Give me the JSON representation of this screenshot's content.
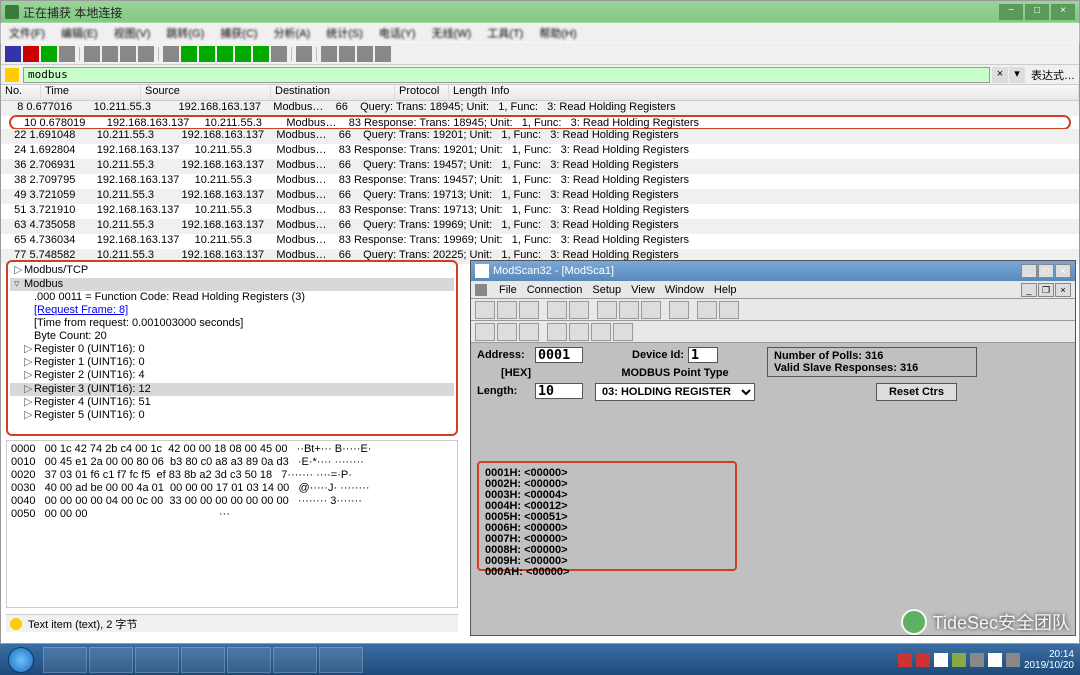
{
  "wireshark": {
    "title": "正在捕获 本地连接",
    "menu": [
      "文件(F)",
      "编辑(E)",
      "视图(V)",
      "跳转(G)",
      "捕获(C)",
      "分析(A)",
      "统计(S)",
      "电话(Y)",
      "无线(W)",
      "工具(T)",
      "帮助(H)"
    ],
    "filter": {
      "value": "modbus",
      "expr_label": "表达式…"
    },
    "columns": {
      "no": "No.",
      "time": "Time",
      "src": "Source",
      "dst": "Destination",
      "proto": "Protocol",
      "len": "Length",
      "info": "Info"
    },
    "packets": [
      {
        "no": "8",
        "time": "0.677016",
        "src": "10.211.55.3",
        "dst": "192.168.163.137",
        "proto": "Modbus…",
        "len": "66",
        "info": "   Query: Trans: 18945; Unit:   1, Func:   3: Read Holding Registers",
        "sel": false,
        "alt": true
      },
      {
        "no": "10",
        "time": "0.678019",
        "src": "192.168.163.137",
        "dst": "10.211.55.3",
        "proto": "Modbus…",
        "len": "83",
        "info": "Response: Trans: 18945; Unit:   1, Func:   3: Read Holding Registers",
        "sel": true,
        "alt": false
      },
      {
        "no": "22",
        "time": "1.691048",
        "src": "10.211.55.3",
        "dst": "192.168.163.137",
        "proto": "Modbus…",
        "len": "66",
        "info": "   Query: Trans: 19201; Unit:   1, Func:   3: Read Holding Registers",
        "sel": false,
        "alt": true
      },
      {
        "no": "24",
        "time": "1.692804",
        "src": "192.168.163.137",
        "dst": "10.211.55.3",
        "proto": "Modbus…",
        "len": "83",
        "info": "Response: Trans: 19201; Unit:   1, Func:   3: Read Holding Registers",
        "sel": false,
        "alt": false
      },
      {
        "no": "36",
        "time": "2.706931",
        "src": "10.211.55.3",
        "dst": "192.168.163.137",
        "proto": "Modbus…",
        "len": "66",
        "info": "   Query: Trans: 19457; Unit:   1, Func:   3: Read Holding Registers",
        "sel": false,
        "alt": true
      },
      {
        "no": "38",
        "time": "2.709795",
        "src": "192.168.163.137",
        "dst": "10.211.55.3",
        "proto": "Modbus…",
        "len": "83",
        "info": "Response: Trans: 19457; Unit:   1, Func:   3: Read Holding Registers",
        "sel": false,
        "alt": false
      },
      {
        "no": "49",
        "time": "3.721059",
        "src": "10.211.55.3",
        "dst": "192.168.163.137",
        "proto": "Modbus…",
        "len": "66",
        "info": "   Query: Trans: 19713; Unit:   1, Func:   3: Read Holding Registers",
        "sel": false,
        "alt": true
      },
      {
        "no": "51",
        "time": "3.721910",
        "src": "192.168.163.137",
        "dst": "10.211.55.3",
        "proto": "Modbus…",
        "len": "83",
        "info": "Response: Trans: 19713; Unit:   1, Func:   3: Read Holding Registers",
        "sel": false,
        "alt": false
      },
      {
        "no": "63",
        "time": "4.735058",
        "src": "10.211.55.3",
        "dst": "192.168.163.137",
        "proto": "Modbus…",
        "len": "66",
        "info": "   Query: Trans: 19969; Unit:   1, Func:   3: Read Holding Registers",
        "sel": false,
        "alt": true
      },
      {
        "no": "65",
        "time": "4.736034",
        "src": "192.168.163.137",
        "dst": "10.211.55.3",
        "proto": "Modbus…",
        "len": "83",
        "info": "Response: Trans: 19969; Unit:   1, Func:   3: Read Holding Registers",
        "sel": false,
        "alt": false
      },
      {
        "no": "77",
        "time": "5.748582",
        "src": "10.211.55.3",
        "dst": "192.168.163.137",
        "proto": "Modbus…",
        "len": "66",
        "info": "   Query: Trans: 20225; Unit:   1, Func:   3: Read Holding Registers",
        "sel": false,
        "alt": true
      }
    ],
    "detail": {
      "l0": "Modbus/TCP",
      "l1": "Modbus",
      "l2": ".000 0011 = Function Code: Read Holding Registers (3)",
      "l3": "[Request Frame: 8]",
      "l4": "[Time from request: 0.001003000 seconds]",
      "l5": "Byte Count: 20",
      "l6": "Register 0 (UINT16): 0",
      "l7": "Register 1 (UINT16): 0",
      "l8": "Register 2 (UINT16): 4",
      "l9": "Register 3 (UINT16): 12",
      "l10": "Register 4 (UINT16): 51",
      "l11": "Register 5 (UINT16): 0"
    },
    "hex": [
      "0000   00 1c 42 74 2b c4 00 1c  42 00 00 18 08 00 45 00   ··Bt+··· B·····E·",
      "0010   00 45 e1 2a 00 00 80 06  b3 80 c0 a8 a3 89 0a d3   ·E·*···· ········",
      "0020   37 03 01 f6 c1 f7 fc f5  ef 83 8b a2 3d c3 50 18   7······· ····=·P·",
      "0030   40 00 ad be 00 00 4a 01  00 00 00 17 01 03 14 00   @·····J· ········",
      "0040   00 00 00 00 04 00 0c 00  33 00 00 00 00 00 00 00   ········ 3·······",
      "0050   00 00 00                                           ···"
    ],
    "status": "Text item (text), 2 字节"
  },
  "modscan": {
    "title": "ModScan32 - [ModSca1]",
    "menu": [
      "File",
      "Connection",
      "Setup",
      "View",
      "Window",
      "Help"
    ],
    "labels": {
      "address": "Address:",
      "hex": "[HEX]",
      "length": "Length:",
      "device_id": "Device Id:",
      "point_type": "MODBUS Point Type",
      "polls": "Number of Polls: 316",
      "valid": "Valid Slave Responses: 316",
      "reset": "Reset Ctrs"
    },
    "values": {
      "address": "0001",
      "length": "10",
      "device_id": "1",
      "point_type": "03: HOLDING REGISTER"
    },
    "data": [
      "0001H: <00000>",
      "0002H: <00000>",
      "0003H: <00004>",
      "0004H: <00012>",
      "0005H: <00051>",
      "0006H: <00000>",
      "0007H: <00000>",
      "0008H: <00000>",
      "0009H: <00000>",
      "000AH: <00000>"
    ]
  },
  "watermark": "TideSec安全团队",
  "taskbar": {
    "time": "20:14",
    "date": "2019/10/20"
  }
}
